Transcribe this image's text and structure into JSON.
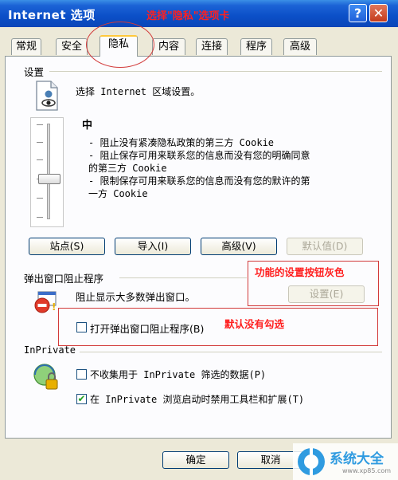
{
  "window": {
    "title": "Internet 选项",
    "help_label": "?",
    "close_label": "✕"
  },
  "annotations": {
    "title_note": "选择\"隐私\"选项卡",
    "disabled_button_note": "功能的设置按钮灰色",
    "unchecked_note": "默认没有勾选"
  },
  "tabs": [
    {
      "label": "常规"
    },
    {
      "label": "安全"
    },
    {
      "label": "隐私",
      "selected": true
    },
    {
      "label": "内容"
    },
    {
      "label": "连接"
    },
    {
      "label": "程序"
    },
    {
      "label": "高级"
    }
  ],
  "settings": {
    "group_label": "设置",
    "prompt": "选择 Internet 区域设置。",
    "level": "中",
    "descriptions": [
      "- 阻止没有紧凑隐私政策的第三方 Cookie",
      "- 阻止保存可用来联系您的信息而没有您的明确同意",
      "的第三方 Cookie",
      "- 限制保存可用来联系您的信息而没有您的默许的第",
      "一方 Cookie"
    ],
    "buttons": {
      "sites": "站点(S)",
      "import": "导入(I)",
      "advanced": "高级(V)",
      "default": "默认值(D)"
    }
  },
  "popup": {
    "group_label": "弹出窗口阻止程序",
    "description": "阻止显示大多数弹出窗口。",
    "settings_button": "设置(E)",
    "checkbox_label": "打开弹出窗口阻止程序(B)",
    "checkbox_checked": false
  },
  "inprivate": {
    "group_label": "InPrivate",
    "checkbox1_label": "不收集用于 InPrivate 筛选的数据(P)",
    "checkbox1_checked": false,
    "checkbox2_label": "在 InPrivate 浏览启动时禁用工具栏和扩展(T)",
    "checkbox2_checked": true,
    "check_mark": "✔"
  },
  "footer": {
    "ok": "确定",
    "cancel": "取消"
  },
  "watermark": {
    "text": "系统大全",
    "url": "www.xp85.com"
  },
  "colors": {
    "titlebar": "#0b4fc7",
    "annotation_red": "#ff2020",
    "dialog_bg": "#ece9d8"
  }
}
